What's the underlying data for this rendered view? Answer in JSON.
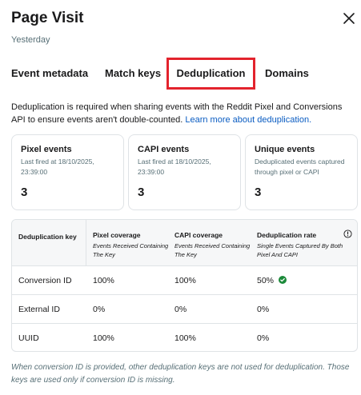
{
  "header": {
    "title": "Page Visit",
    "subtitle": "Yesterday"
  },
  "tabs": [
    {
      "label": "Event metadata"
    },
    {
      "label": "Match keys"
    },
    {
      "label": "Deduplication"
    },
    {
      "label": "Domains"
    }
  ],
  "active_tab": "Deduplication",
  "description": {
    "text": "Deduplication is required when sharing events with the Reddit Pixel and Conversions API to ensure events aren't double-counted. ",
    "link": "Learn more about deduplication."
  },
  "cards": [
    {
      "title": "Pixel events",
      "sub": "Last fired at 18/10/2025, 23:39:00",
      "value": "3"
    },
    {
      "title": "CAPI events",
      "sub": "Last fired at 18/10/2025, 23:39:00",
      "value": "3"
    },
    {
      "title": "Unique events",
      "sub": "Deduplicated events captured through pixel or CAPI",
      "value": "3"
    }
  ],
  "table": {
    "headers": [
      {
        "label": "Deduplication key",
        "sub": ""
      },
      {
        "label": "Pixel coverage",
        "sub": "Events Received Containing The Key"
      },
      {
        "label": "CAPI coverage",
        "sub": "Events Received Containing The Key"
      },
      {
        "label": "Deduplication rate",
        "sub": "Single Events Captured By Both Pixel And CAPI"
      }
    ],
    "rows": [
      {
        "key": "Conversion ID",
        "pixel": "100%",
        "capi": "100%",
        "rate": "50%",
        "rate_ok": true
      },
      {
        "key": "External ID",
        "pixel": "0%",
        "capi": "0%",
        "rate": "0%",
        "rate_ok": false
      },
      {
        "key": "UUID",
        "pixel": "100%",
        "capi": "100%",
        "rate": "0%",
        "rate_ok": false
      }
    ]
  },
  "footnote": "When conversion ID is provided, other deduplication keys are not used for deduplication. Those keys are used only if conversion ID is missing.",
  "colors": {
    "accent_link": "#0a5cc2",
    "highlight_border": "#e3232d",
    "success": "#1c8a3a"
  },
  "icons": {
    "close": "close-icon",
    "info": "info-icon",
    "check": "check-circle-icon"
  }
}
